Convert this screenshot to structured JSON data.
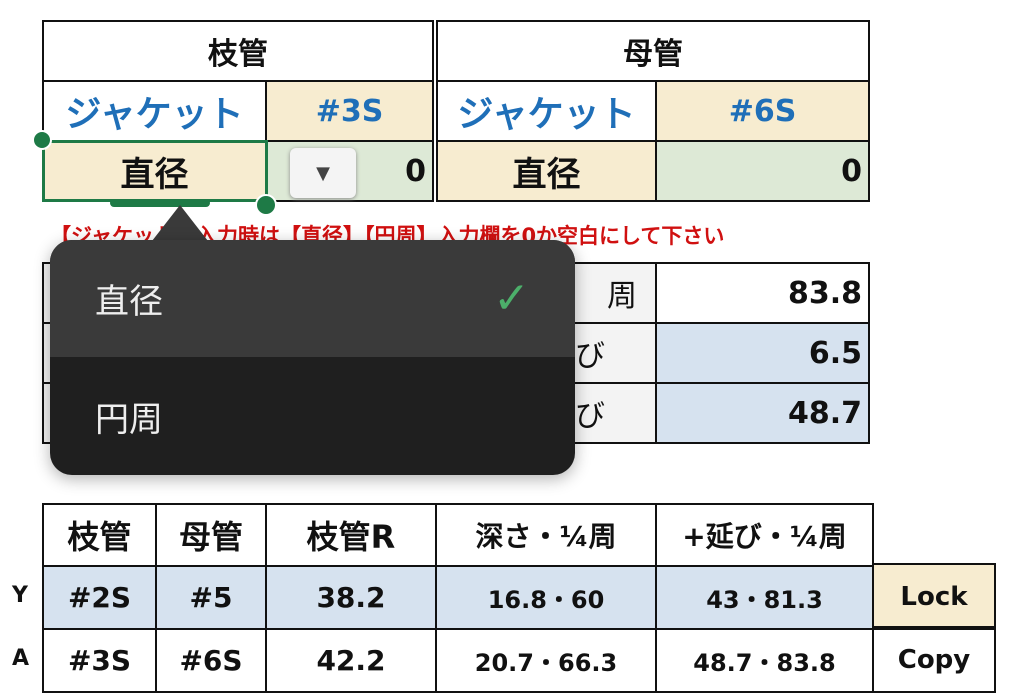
{
  "top": {
    "branch_title": "枝管",
    "main_title": "母管",
    "jacket": "ジャケット",
    "branch_size": "#3S",
    "main_size": "#6S",
    "diameter": "直径",
    "branch_value": "0",
    "main_value": "0"
  },
  "warning": "【ジャケット】入力時は【直径】【円周】入力欄を0か空白にして下さい",
  "middle": {
    "rows": [
      {
        "label": "周",
        "value": "83.8"
      },
      {
        "label": "び",
        "value": "6.5"
      },
      {
        "label": "び",
        "value": "48.7"
      }
    ]
  },
  "dropdown": {
    "items": [
      {
        "label": "直径",
        "selected": true
      },
      {
        "label": "円周",
        "selected": false
      }
    ]
  },
  "bottom": {
    "headers": [
      "枝管",
      "母管",
      "枝管R",
      "深さ・¼周",
      "+延び・¼周"
    ],
    "rows": [
      {
        "label": "Y",
        "cells": [
          "#2S",
          "#5",
          "38.2",
          "16.8・60",
          "43・81.3"
        ],
        "action": "Lock"
      },
      {
        "label": "A",
        "cells": [
          "#3S",
          "#6S",
          "42.2",
          "20.7・66.3",
          "48.7・83.8"
        ],
        "action": "Copy"
      }
    ]
  },
  "colors": {
    "accent": "#1e7a46",
    "warning": "#d01010",
    "jacket": "#1f6fb8"
  }
}
